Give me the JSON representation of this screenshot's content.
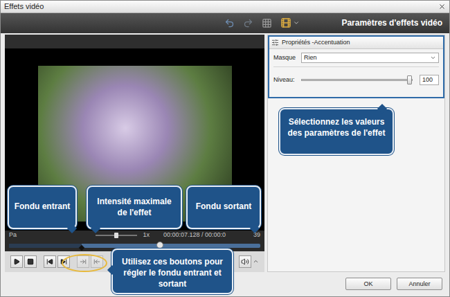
{
  "window": {
    "title": "Effets vidéo"
  },
  "toolbar": {
    "title": "Paramètres d'effets vidéo"
  },
  "player": {
    "status": "Pa",
    "speed": "1x",
    "speed_level": 0.5,
    "time": "00:00:07.128 / 00:00:0",
    "time_end": "39",
    "position_level": 0.6,
    "fade_in_level": 0.29,
    "controls": [
      {
        "kind": "play",
        "disabled": false
      },
      {
        "kind": "stop",
        "disabled": false
      },
      {
        "kind": "prev",
        "disabled": false
      },
      {
        "kind": "next",
        "disabled": false
      },
      {
        "kind": "fadein",
        "disabled": true
      },
      {
        "kind": "fadeout",
        "disabled": true
      }
    ]
  },
  "properties": {
    "title": "Propriétés -Accentuation",
    "fields": [
      {
        "kind": "select",
        "label": "Masque",
        "value": "Rien"
      },
      {
        "kind": "slider",
        "label": "Niveau:",
        "level": 1,
        "value": "100"
      }
    ]
  },
  "callouts": [
    {
      "text": "Fondu entrant"
    },
    {
      "text": "Intensité maximale de l'effet"
    },
    {
      "text": "Fondu sortant"
    },
    {
      "text": "Utilisez ces boutons pour régler le fondu entrant et sortant"
    },
    {
      "text": "Sélectionnez les valeurs des paramètres de l'effet"
    }
  ],
  "buttons": [
    {
      "label": "OK"
    },
    {
      "label": "Annuler"
    }
  ]
}
